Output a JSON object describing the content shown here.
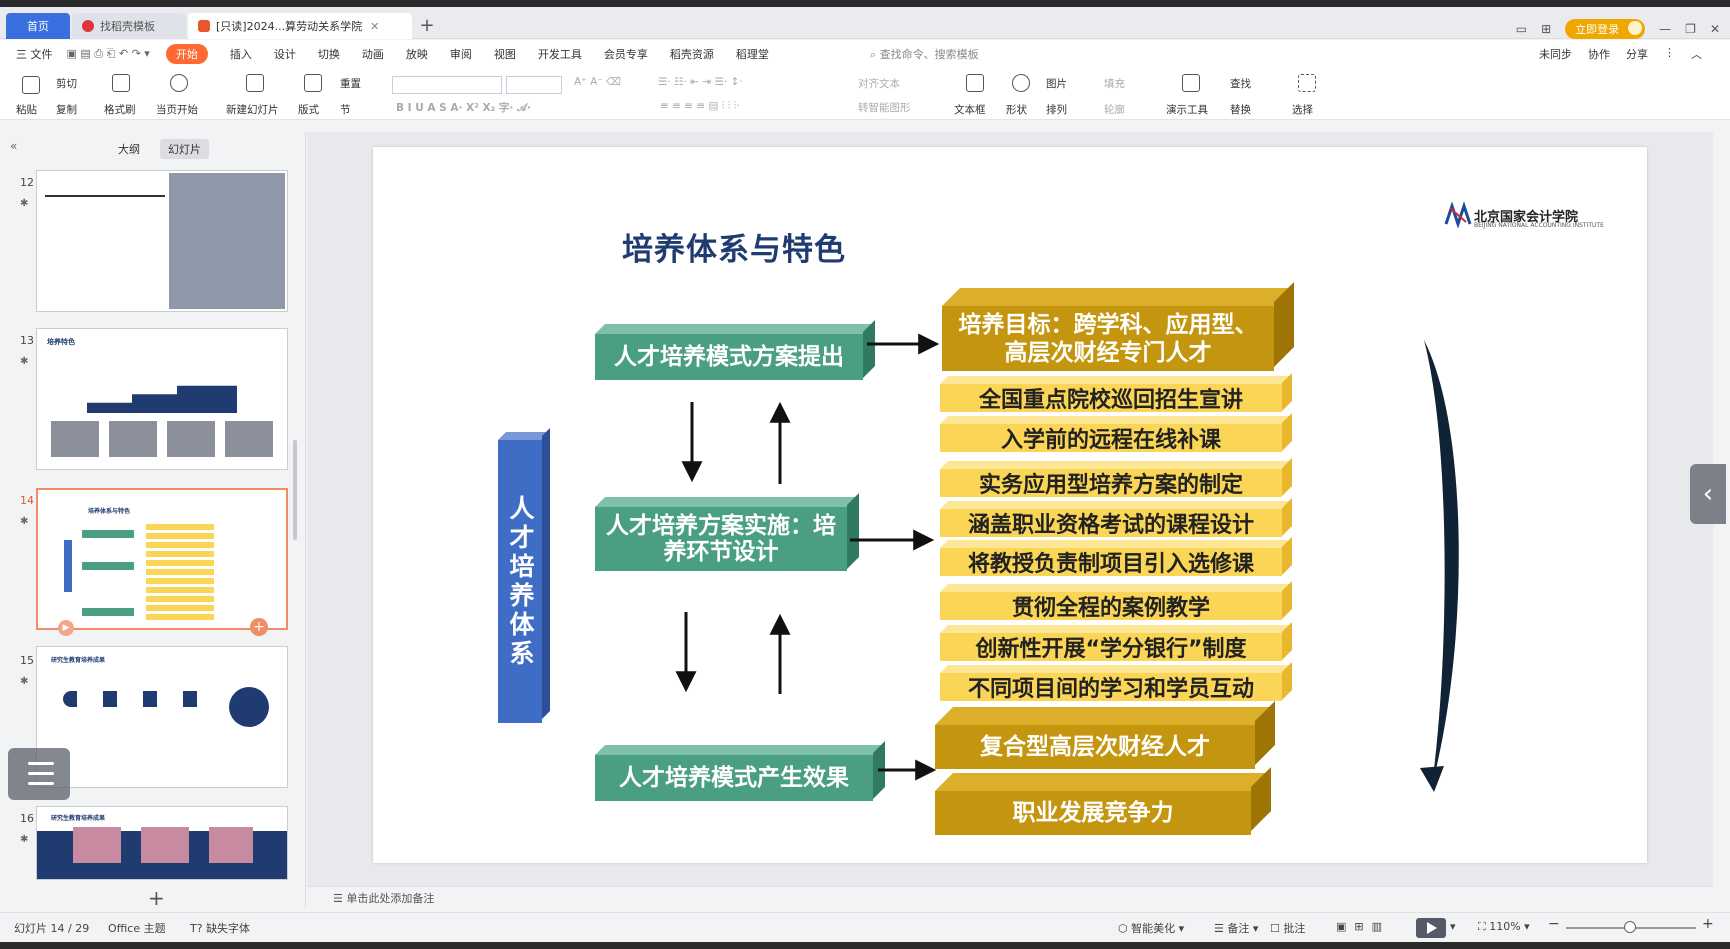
{
  "titlebar": {
    "tabs": [
      {
        "label": "首页"
      },
      {
        "label": "找稻壳模板"
      },
      {
        "label": "[只读]2024...算劳动关系学院"
      }
    ],
    "login_label": "立即登录"
  },
  "menubar": {
    "file_label": "三 文件",
    "items": [
      "开始",
      "插入",
      "设计",
      "切换",
      "动画",
      "放映",
      "审阅",
      "视图",
      "开发工具",
      "会员专享",
      "稻壳资源",
      "稻理堂"
    ],
    "search_placeholder": "查找命令、搜索模板",
    "right_items": [
      "未同步",
      "协作",
      "分享"
    ]
  },
  "toolbar": {
    "paste": "粘贴",
    "cut": "剪切",
    "copy": "复制",
    "format_painter": "格式刷",
    "from_current": "当页开始",
    "new_slide": "新建幻灯片",
    "layout": "版式",
    "section": "节",
    "reset": "重置",
    "text_align": "对齐文本",
    "to_smartart": "转智能图形",
    "textbox": "文本框",
    "shape": "形状",
    "picture": "图片",
    "arrange": "排列",
    "fill": "填充",
    "outline": "轮廓",
    "present_tools": "演示工具",
    "find": "查找",
    "replace": "替换",
    "select": "选择"
  },
  "sidebar": {
    "tab_outline": "大纲",
    "tab_slides": "幻灯片",
    "slide_numbers": [
      "12",
      "13",
      "14",
      "15",
      "16"
    ],
    "thumb_titles": [
      "",
      "培养特色",
      "培养体系与特色",
      "研究生教育培养成果",
      "研究生教育培养成果"
    ]
  },
  "slide": {
    "title": "培养体系与特色",
    "logo_name": "北京国家会计学院",
    "logo_sub": "BEIJING NATIONAL ACCOUNTING INSTITUTE",
    "vertical_box": "人才培养体系",
    "green_boxes": [
      "人才培养模式方案提出",
      "人才培养方案实施：培养环节设计",
      "人才培养模式产生效果"
    ],
    "goal_box": "培养目标：跨学科、应用型、高层次财经专门人才",
    "yellow_bars": [
      "全国重点院校巡回招生宣讲",
      "入学前的远程在线补课",
      "实务应用型培养方案的制定",
      "涵盖职业资格考试的课程设计",
      "将教授负责制项目引入选修课",
      "贯彻全程的案例教学",
      "创新性开展“学分银行”制度",
      "不同项目间的学习和学员互动"
    ],
    "result_boxes": [
      "复合型高层次财经人才",
      "职业发展竞争力"
    ]
  },
  "notes": {
    "placeholder": "单击此处添加备注"
  },
  "statusbar": {
    "slide_counter": "幻灯片 14 / 29",
    "theme": "Office 主题",
    "missing_font": "缺失字体",
    "smart_beautify": "智能美化",
    "notes_btn": "备注",
    "comment_btn": "批注",
    "zoom": "110%"
  },
  "colors": {
    "green": "#4a9f82",
    "yellow": "#fad556",
    "gold": "#c4950e",
    "blue": "#3f6dc6",
    "accent": "#ff6a33"
  }
}
